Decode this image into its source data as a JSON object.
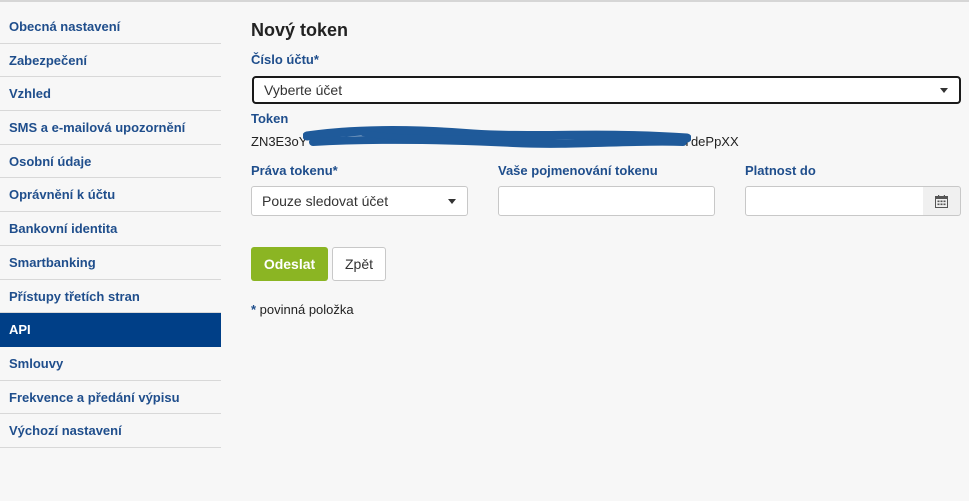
{
  "sidebar": {
    "items": [
      {
        "label": "Obecná nastavení"
      },
      {
        "label": "Zabezpečení"
      },
      {
        "label": "Vzhled"
      },
      {
        "label": "SMS a e-mailová upozornění"
      },
      {
        "label": "Osobní údaje"
      },
      {
        "label": "Oprávnění k účtu"
      },
      {
        "label": "Bankovní identita"
      },
      {
        "label": "Smartbanking"
      },
      {
        "label": "Přístupy třetích stran"
      },
      {
        "label": "API"
      },
      {
        "label": "Smlouvy"
      },
      {
        "label": "Frekvence a předání výpisu"
      },
      {
        "label": "Výchozí nastavení"
      }
    ],
    "active": "API"
  },
  "form": {
    "title": "Nový token",
    "account_label": "Číslo účtu*",
    "account_select": "Vyberte účet",
    "token_label": "Token",
    "token_prefix": "ZN3E3oY",
    "token_suffix": "TdePpXX",
    "rights_label": "Práva tokenu*",
    "rights_select": "Pouze sledovat účet",
    "name_label": "Vaše pojmenování tokenu",
    "name_value": "",
    "validity_label": "Platnost do",
    "validity_value": "",
    "calendar_icon": "calendar-icon",
    "submit_label": "Odeslat",
    "back_label": "Zpět",
    "required_star": "*",
    "required_note": " povinná položka"
  },
  "colors": {
    "link": "#1f4e8c",
    "active_bg": "#003f87",
    "primary_button": "#8bb523",
    "redaction": "#1f5a9a"
  }
}
